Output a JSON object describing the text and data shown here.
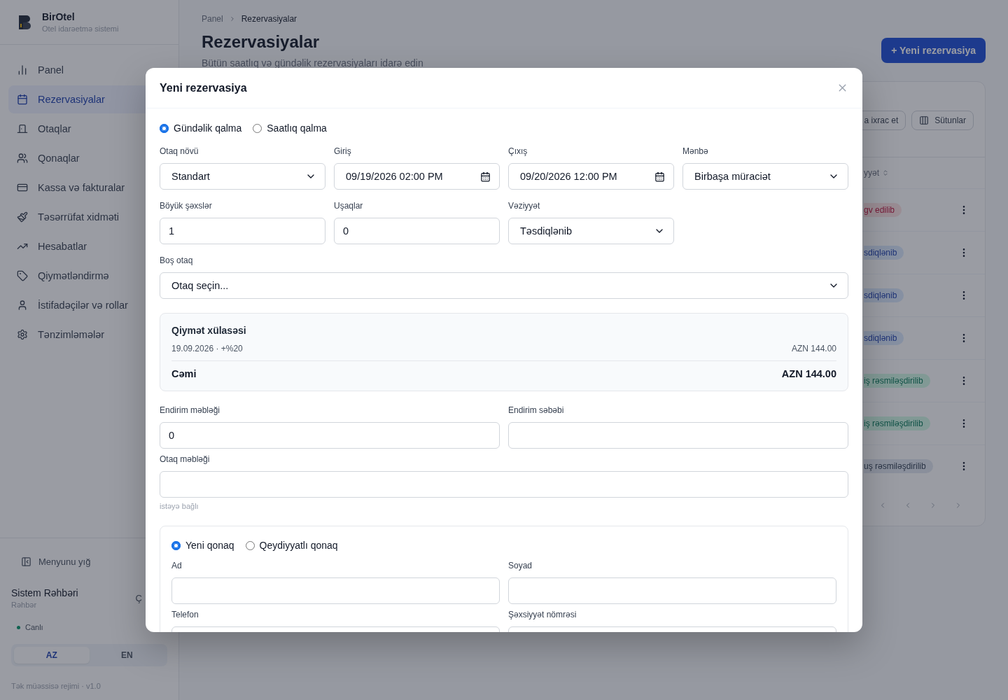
{
  "brand": {
    "name": "BirOtel",
    "tagline": "Otel idarəetmə sistemi"
  },
  "sidebar": {
    "items": [
      {
        "label": "Panel",
        "selected": false
      },
      {
        "label": "Rezervasiyalar",
        "selected": true
      },
      {
        "label": "Otaqlar",
        "selected": false
      },
      {
        "label": "Qonaqlar",
        "selected": false
      },
      {
        "label": "Kassa və fakturalar",
        "selected": false
      },
      {
        "label": "Təsərrüfat xidməti",
        "selected": false
      },
      {
        "label": "Hesabatlar",
        "selected": false
      },
      {
        "label": "Qiymətləndirmə",
        "selected": false
      },
      {
        "label": "İstifadəçilər və rollar",
        "selected": false
      },
      {
        "label": "Tənzimləmələr",
        "selected": false
      }
    ],
    "collapse": "Menyunu yığ",
    "user": {
      "name": "Sistem Rəhbəri",
      "role": "Rəhbər",
      "cut_action": "Ç"
    },
    "status": "Canlı",
    "languages": [
      {
        "label": "AZ",
        "selected": true
      },
      {
        "label": "EN",
        "selected": false
      }
    ],
    "footer": "Tək müəssisə rejimi · v1.0"
  },
  "page": {
    "breadcrumb": [
      "Panel",
      "Rezervasiyalar"
    ],
    "title": "Rezervasiyalar",
    "subtitle": "Bütün saatlıq və gündəlik rezervasiyaları idarə edin",
    "new_button": "+ Yeni rezervasiya",
    "toolbar": [
      "a ixrac et",
      "Sütunlar"
    ],
    "column_header": "yyət",
    "statuses": [
      {
        "label": "gv edilib",
        "kind": "cancelled"
      },
      {
        "label": "sdiqlənib",
        "kind": "confirmed"
      },
      {
        "label": "sdiqlənib",
        "kind": "confirmed"
      },
      {
        "label": "sdiqlənib",
        "kind": "confirmed"
      },
      {
        "label": "iş rəsmiləşdirilib",
        "kind": "checkedin"
      },
      {
        "label": "iş rəsmiləşdirilib",
        "kind": "checkedin"
      },
      {
        "label": "uş rəsmiləşdirilib",
        "kind": "checkedout"
      }
    ]
  },
  "modal": {
    "title": "Yeni rezervasiya",
    "stay_types": [
      {
        "label": "Gündəlik qalma",
        "selected": true
      },
      {
        "label": "Saatlıq qalma",
        "selected": false
      }
    ],
    "row1": [
      {
        "label": "Otaq növü",
        "value": "Standart",
        "kind": "select"
      },
      {
        "label": "Giriş",
        "value": "09/19/2026 02:00 PM",
        "kind": "date"
      },
      {
        "label": "Çıxış",
        "value": "09/20/2026 12:00 PM",
        "kind": "date"
      },
      {
        "label": "Mənbə",
        "value": "Birbaşa müraciət",
        "kind": "select"
      }
    ],
    "row2": [
      {
        "label": "Böyük şəxslər",
        "value": "1",
        "kind": "input"
      },
      {
        "label": "Uşaqlar",
        "value": "0",
        "kind": "input"
      },
      {
        "label": "Vəziyyət",
        "value": "Təsdiqlənib",
        "kind": "select"
      }
    ],
    "room": {
      "label": "Boş otaq",
      "value": "Otaq seçin..."
    },
    "summary": {
      "title": "Qiymət xülasəsi",
      "line_label": "19.09.2026 · +%20",
      "line_value": "AZN 144.00",
      "total_label": "Cəmi",
      "total_value": "AZN 144.00"
    },
    "discount": [
      {
        "label": "Endirim məbləği",
        "value": "0"
      },
      {
        "label": "Endirim səbəbi"
      }
    ],
    "room_amount": {
      "label": "Otaq məbləği",
      "hint": "istəyə bağlı"
    },
    "guest_types": [
      {
        "label": "Yeni qonaq",
        "selected": true
      },
      {
        "label": "Qeydiyyatlı qonaq",
        "selected": false
      }
    ],
    "guest_fields": [
      {
        "label": "Ad"
      },
      {
        "label": "Soyad"
      },
      {
        "label": "Telefon"
      },
      {
        "label": "Şəxsiyyət nömrəsi"
      }
    ]
  }
}
